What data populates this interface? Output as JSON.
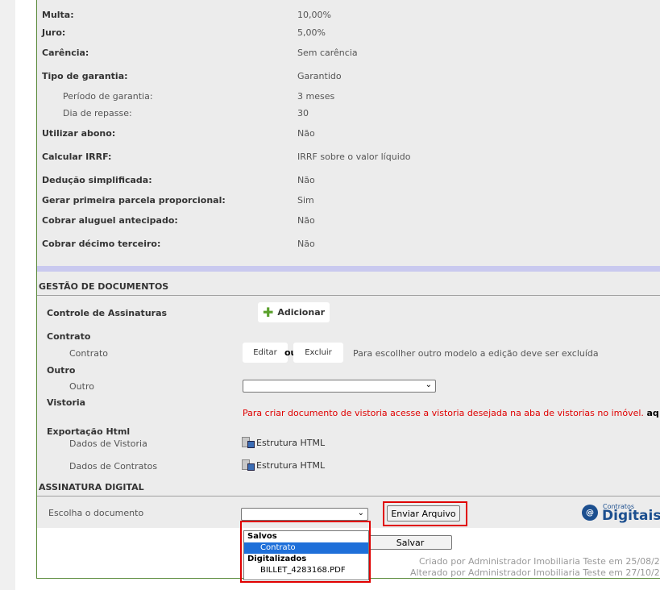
{
  "details": [
    {
      "label": "Multa:",
      "value": "10,00%"
    },
    {
      "label": "Juro:",
      "value": "5,00%"
    },
    {
      "label": "Carência:",
      "value": "Sem carência"
    },
    {
      "label": "Tipo de garantia:",
      "value": "Garantido"
    },
    {
      "label": "Período de garantia:",
      "value": "3 meses"
    },
    {
      "label": "Dia de repasse:",
      "value": "30"
    },
    {
      "label": "Utilizar abono:",
      "value": "Não"
    },
    {
      "label": "Calcular IRRF:",
      "value": "IRRF sobre o valor líquido"
    },
    {
      "label": "Dedução simplificada:",
      "value": "Não"
    },
    {
      "label": "Gerar primeira parcela proporcional:",
      "value": "Sim"
    },
    {
      "label": "Cobrar aluguel antecipado:",
      "value": "Não"
    },
    {
      "label": "Cobrar décimo terceiro:",
      "value": "Não"
    }
  ],
  "gestao": {
    "title": "GESTÃO DE DOCUMENTOS",
    "controle_label": "Controle de Assinaturas",
    "adicionar_label": "Adicionar",
    "contrato_heading": "Contrato",
    "contrato_sub": "Contrato",
    "editar_label": "Editar",
    "ou_label": "ou",
    "excluir_label": "Excluir",
    "contrato_note": "Para escollher outro modelo a edição deve ser excluída",
    "outro_heading": "Outro",
    "outro_sub": "Outro",
    "vistoria_heading": "Vistoria",
    "vistoria_note": "Para criar documento de vistoria acesse a vistoria desejada na aba de vistorias no imóvel.",
    "vistoria_link": "aq",
    "exportacao_heading": "Exportação Html",
    "dados_vistoria": "Dados de Vistoria",
    "dados_contratos": "Dados de Contratos",
    "estrutura_html": "Estrutura HTML"
  },
  "assinatura": {
    "title": "ASSINATURA DIGITAL",
    "escolha_label": "Escolha o documento",
    "enviar_label": "Enviar Arquivo",
    "logo_small": "Contratos",
    "logo_big": "Digitais",
    "dropdown": {
      "group1": "Salvos",
      "option1": "Contrato",
      "group2": "Digitalizados",
      "option2": "BILLET_4283168.PDF"
    }
  },
  "footer": {
    "salvar_label": "Salvar",
    "criado": "Criado por Administrador Imobiliaria Teste em 25/08/2",
    "alterado": "Alterado por Administrador Imobiliaria Teste em 27/10/2"
  },
  "colors": {
    "highlight_box": "#e00000",
    "selected_option": "#1e6fd9",
    "panel_border": "#5a8a3a"
  }
}
